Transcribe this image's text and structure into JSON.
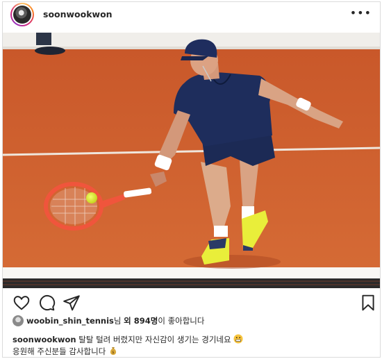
{
  "post": {
    "author": "soonwookwon",
    "more_icon_glyph": "•••",
    "photo_alt": "Tennis player on a clay court"
  },
  "actions": {
    "icons": [
      "heart-icon",
      "comment-icon",
      "share-icon",
      "bookmark-icon"
    ]
  },
  "likes": {
    "liker": "woobin_shin_tennis",
    "suffix_nim": "님",
    "others": "외 894명",
    "suffix": "이 좋아합니다"
  },
  "caption": {
    "author": "soonwookwon",
    "line1": "탈탈 털려 버렸지만 자신감이 생기는 경기네요",
    "line2": "응원해 주신분들 감사합니다",
    "emoji1": "grimace-face",
    "emoji2": "money-bag"
  },
  "colors": {
    "clay": "#d4652c",
    "line_white": "#f4f1ec",
    "text": "#262626",
    "border": "#dbdbdb"
  }
}
